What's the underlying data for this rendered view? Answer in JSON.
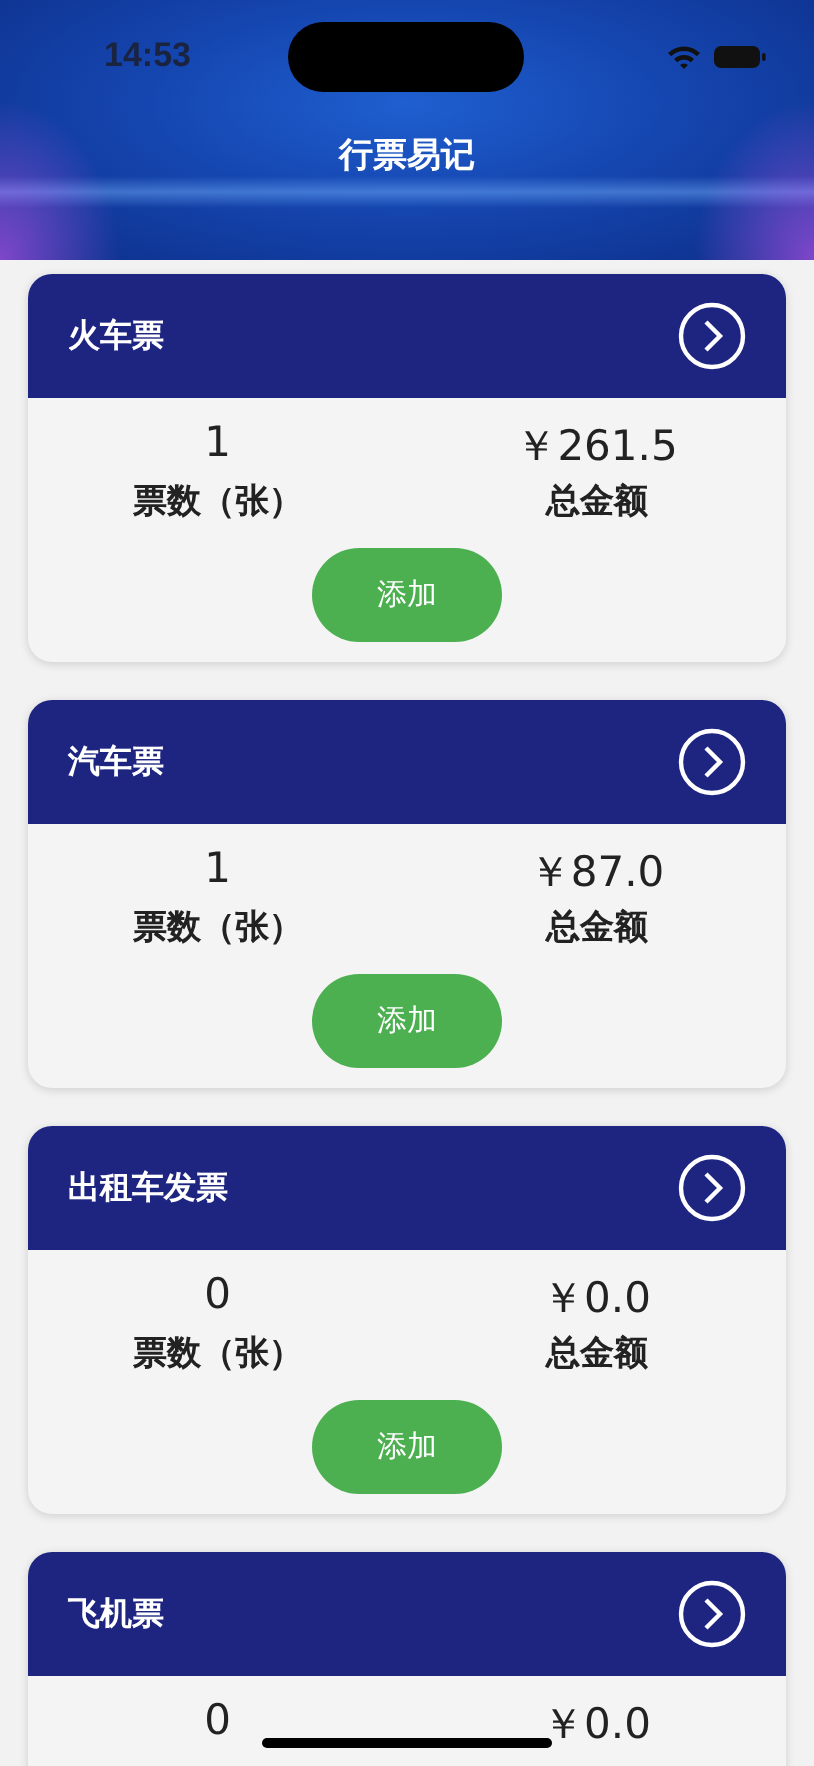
{
  "status_bar": {
    "time": "14:53"
  },
  "header": {
    "title": "行票易记"
  },
  "cards": [
    {
      "title": "火车票",
      "count": "1",
      "amount": "￥261.5",
      "count_label": "票数（张）",
      "amount_label": "总金额",
      "button": "添加"
    },
    {
      "title": "汽车票",
      "count": "1",
      "amount": "￥87.0",
      "count_label": "票数（张）",
      "amount_label": "总金额",
      "button": "添加"
    },
    {
      "title": "出租车发票",
      "count": "0",
      "amount": "￥0.0",
      "count_label": "票数（张）",
      "amount_label": "总金额",
      "button": "添加"
    },
    {
      "title": "飞机票",
      "count": "0",
      "amount": "￥0.0"
    }
  ]
}
